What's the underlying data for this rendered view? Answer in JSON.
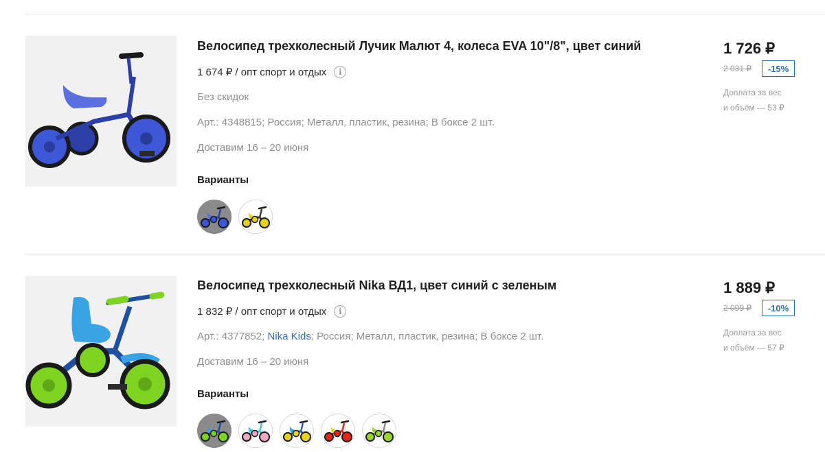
{
  "products": [
    {
      "title": "Велосипед трехколесный Лучик Малют 4, колеса EVA 10\"/8\", цвет синий",
      "wholesale_price": "1 674 ₽ / опт спорт и отдых",
      "no_discount": "Без скидок",
      "attributes": {
        "article": "Арт.: 4348815;",
        "country": "Россия;",
        "material": "Металл, пластик, резина;",
        "box": "В боксе 2 шт."
      },
      "delivery": "Доставим 16 – 20 июня",
      "variants_label": "Варианты",
      "price": "1 726 ₽",
      "old_price": "2 031 ₽",
      "discount": "-15%",
      "surcharge_line1": "Доплата за вес",
      "surcharge_line2": "и объём — 53 ₽",
      "colors": {
        "frame": "#2c3fa8",
        "seat": "#5a6fe0",
        "wheel": "#3e57d6"
      },
      "variant_colors": [
        {
          "frame": "#2c3fa8",
          "seat": "#5a6fe0",
          "wheel": "#3e57d6"
        },
        {
          "frame": "#3a3a3a",
          "seat": "#e3d11a",
          "wheel": "#e3d11a"
        }
      ]
    },
    {
      "title": "Велосипед трехколесный Nika ВД1, цвет синий с зеленым",
      "wholesale_price": "1 832 ₽ / опт спорт и отдых",
      "attributes": {
        "article": "Арт.: 4377852;",
        "brand": "Nika Kids",
        "country": "Россия;",
        "material": "Металл, пластик, резина;",
        "box": "В боксе 2 шт."
      },
      "delivery": "Доставим 16 – 20 июня",
      "variants_label": "Варианты",
      "price": "1 889 ₽",
      "old_price": "2 099 ₽",
      "discount": "-10%",
      "surcharge_line1": "Доплата за вес",
      "surcharge_line2": "и объём — 57 ₽",
      "colors": {
        "frame": "#1f4fa0",
        "seat": "#3aa3e6",
        "wheel": "#7fd321"
      },
      "variant_colors": [
        {
          "frame": "#1f4fa0",
          "seat": "#3aa3e6",
          "wheel": "#7fd321"
        },
        {
          "frame": "#3fc5d6",
          "seat": "#3fc5d6",
          "wheel": "#f1a7c6"
        },
        {
          "frame": "#2c5fb0",
          "seat": "#3aa3e6",
          "wheel": "#e7d41c"
        },
        {
          "frame": "#e1261c",
          "seat": "#f2dd1c",
          "wheel": "#e1261c"
        },
        {
          "frame": "#8a8a8a",
          "seat": "#9bd42a",
          "wheel": "#9bd42a"
        }
      ]
    }
  ]
}
